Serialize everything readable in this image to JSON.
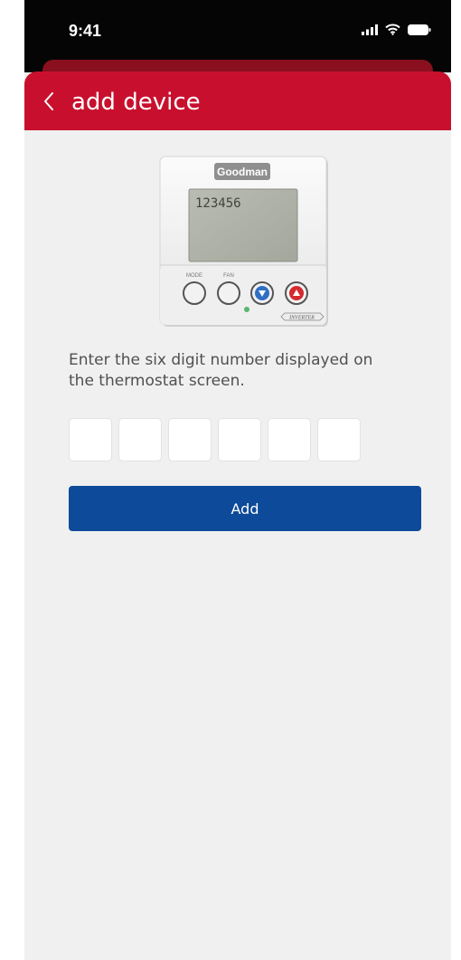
{
  "status_bar": {
    "time": "9:41",
    "icons": [
      "cellular-signal-icon",
      "wifi-icon",
      "battery-icon"
    ]
  },
  "header": {
    "back_icon": "chevron-left-icon",
    "title": "add device",
    "color": "#c8102e"
  },
  "thermostat_image": {
    "brand": "Goodman",
    "display_value": "123456",
    "mode_label": "MODE",
    "fan_label": "FAN",
    "badge_label": "INVERTER"
  },
  "instruction": "Enter the six digit number displayed on the thermostat screen.",
  "digit_inputs": [
    "",
    "",
    "",
    "",
    "",
    ""
  ],
  "add_button": {
    "label": "Add",
    "color": "#0d4a99"
  }
}
